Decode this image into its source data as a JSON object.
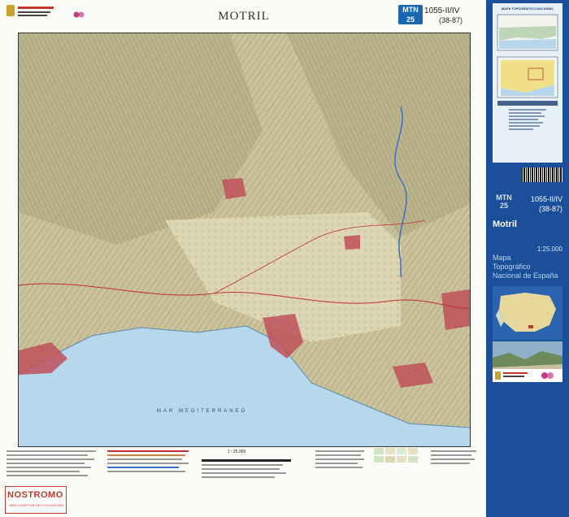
{
  "sheet": {
    "title": "MOTRIL",
    "badge": "MTN 25",
    "number": "1055-II/IV",
    "code": "(38-87)"
  },
  "map": {
    "sea_label": "MAR MEDITERRANEO",
    "colors": {
      "sea": "#b6d7ec",
      "land": "#c9c29a",
      "urban": "#c0505a",
      "relief": "#8c7a54",
      "river": "#3a6fd0"
    }
  },
  "legend": {
    "scale": "1 : 25.000"
  },
  "cover": {
    "panel_title": "MAPA TOPOGRÁFICO NACIONAL",
    "badge": "MTN 25",
    "number": "1055-II/IV",
    "code": "(38-87)",
    "name": "Motril",
    "scale": "1:25.000",
    "series_line1": "Mapa",
    "series_line2": "Topográfico",
    "series_line3": "Nacional de España",
    "background": "#1b4f9a"
  },
  "watermark": {
    "brand": "NOSTROMO",
    "tagline": "WEB COMPTOIR DES VOYAGEURS"
  }
}
